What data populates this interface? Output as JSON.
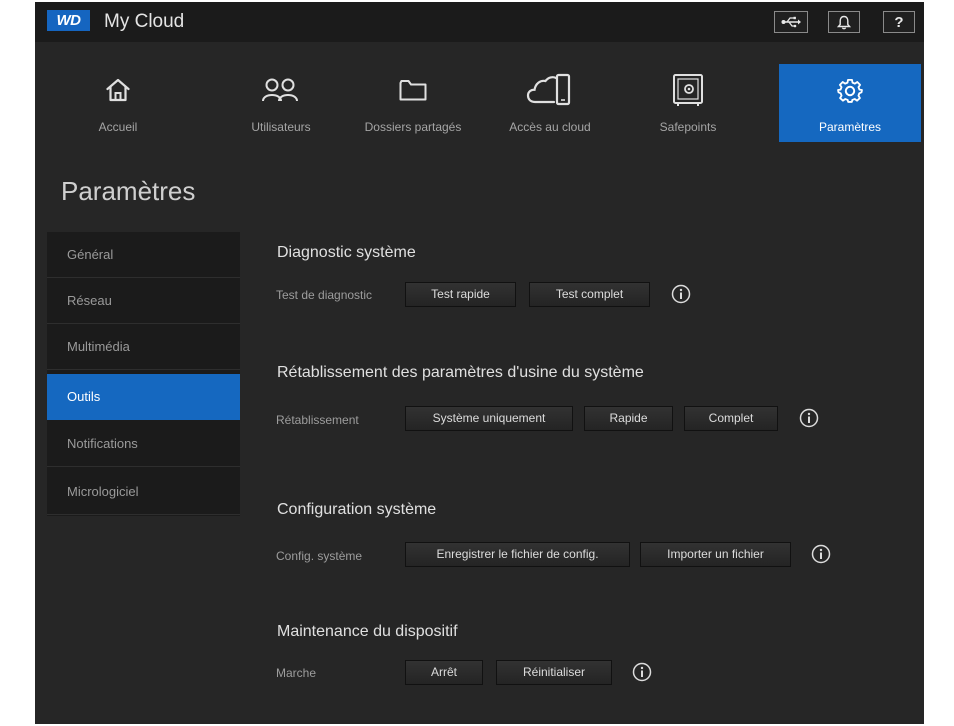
{
  "topbar": {
    "logo_text": "WD",
    "app_title": "My Cloud",
    "usb_icon": "usb-icon",
    "bell_icon": "bell-icon",
    "help_label": "?"
  },
  "nav": {
    "items": [
      {
        "id": "accueil",
        "label": "Accueil",
        "icon": "home-icon"
      },
      {
        "id": "utilisateurs",
        "label": "Utilisateurs",
        "icon": "users-icon"
      },
      {
        "id": "dossiers",
        "label": "Dossiers partagés",
        "icon": "folder-icon"
      },
      {
        "id": "cloud",
        "label": "Accès au cloud",
        "icon": "cloud-device-icon"
      },
      {
        "id": "safepoints",
        "label": "Safepoints",
        "icon": "safe-icon"
      },
      {
        "id": "parametres",
        "label": "Paramètres",
        "icon": "gear-icon",
        "active": true
      }
    ]
  },
  "page": {
    "title": "Paramètres"
  },
  "side_menu": {
    "items": [
      {
        "label": "Général"
      },
      {
        "label": "Réseau"
      },
      {
        "label": "Multimédia"
      },
      {
        "label": "Outils",
        "active": true
      },
      {
        "label": "Notifications"
      },
      {
        "label": "Micrologiciel"
      }
    ]
  },
  "sections": {
    "diagnostic": {
      "title": "Diagnostic système",
      "row_label": "Test de diagnostic",
      "buttons": [
        "Test rapide",
        "Test complet"
      ]
    },
    "factory_reset": {
      "title": "Rétablissement des paramètres d'usine du système",
      "row_label": "Rétablissement",
      "buttons": [
        "Système uniquement",
        "Rapide",
        "Complet"
      ]
    },
    "config": {
      "title": "Configuration système",
      "row_label": "Config. système",
      "buttons": [
        "Enregistrer le fichier de config.",
        "Importer un fichier"
      ]
    },
    "maintenance": {
      "title": "Maintenance du dispositif",
      "row_label": "Marche",
      "buttons": [
        "Arrêt",
        "Réinitialiser"
      ]
    }
  },
  "colors": {
    "accent": "#1568c0",
    "background": "#262626",
    "topbar": "#1b1b1b"
  }
}
